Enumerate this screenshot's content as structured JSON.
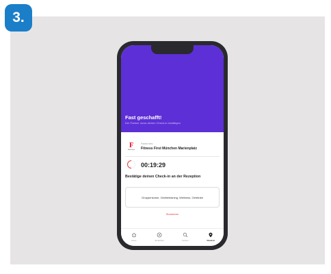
{
  "step_badge": "3.",
  "hero": {
    "title": "Fast geschafft!",
    "subtitle": "Der Partner muss deinen Check-in bestätigen"
  },
  "partner": {
    "label": "Partner fees",
    "name": "Fitness First München Marienplatz",
    "logo_text": "FitnessFirst"
  },
  "timer": "00:19:29",
  "confirm_heading": "Bestätige deinen Check-in an der Rezeption",
  "services": "Gruppenkurse, Gerätetraining, Wellness, Getränke",
  "cancel_label": "Stornieren",
  "tabbar": {
    "items": [
      {
        "label": "Home",
        "icon": "home-icon"
      },
      {
        "label": "Entdecken",
        "icon": "compass-icon"
      },
      {
        "label": "Suchen",
        "icon": "search-icon"
      },
      {
        "label": "Check-in",
        "icon": "location-pin-icon",
        "active": true
      }
    ]
  },
  "colors": {
    "badge": "#1b7ec8",
    "hero": "#5d2fd6",
    "accent_red": "#e33a3a",
    "logo_red": "#e3001b"
  }
}
